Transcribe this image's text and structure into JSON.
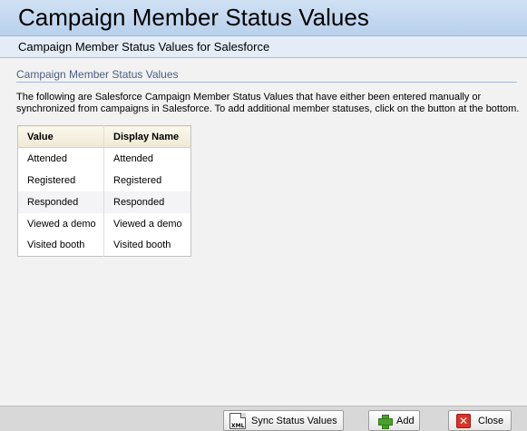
{
  "header": {
    "title": "Campaign Member Status Values",
    "subtitle": "Campaign Member Status Values for Salesforce"
  },
  "section": {
    "title": "Campaign Member Status Values",
    "description": "The following are Salesforce Campaign Member Status Values that have either been entered manually or synchronized from campaigns in Salesforce. To add additional member statuses, click on the button at the bottom."
  },
  "table": {
    "columns": [
      "Value",
      "Display Name"
    ],
    "rows": [
      {
        "value": "Attended",
        "display": "Attended"
      },
      {
        "value": "Registered",
        "display": "Registered"
      },
      {
        "value": "Responded",
        "display": "Responded"
      },
      {
        "value": "Viewed a demo",
        "display": "Viewed a demo"
      },
      {
        "value": "Visited booth",
        "display": "Visited booth"
      }
    ]
  },
  "footer": {
    "sync_label": "Sync Status Values",
    "sync_icon": "xml-icon",
    "sync_icon_text": "XML",
    "add_label": "Add",
    "add_icon": "plus-icon",
    "close_label": "Close",
    "close_icon": "close-icon",
    "close_icon_glyph": "✕"
  }
}
